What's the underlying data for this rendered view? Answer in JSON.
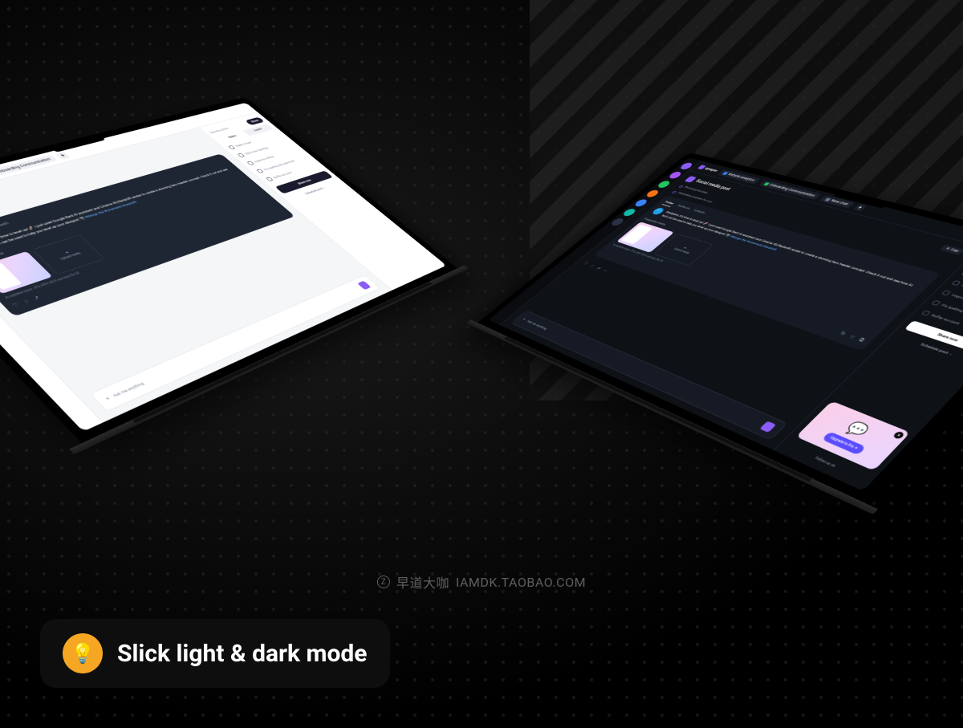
{
  "badge": {
    "text": "Slick light & dark mode"
  },
  "watermark": {
    "brand1": "早道大咖",
    "brand2": "IAMDK.TAOBAO.COM"
  },
  "app": {
    "name": "synapse",
    "tabs": [
      {
        "label": "Website analytics",
        "color": "#3b82f6"
      },
      {
        "label": "Onboarding Communication",
        "color": "#22c55e"
      }
    ],
    "dark_tab": {
      "label": "New chat"
    },
    "section_title": "Social media post",
    "steps": {
      "browsing": "Browsing the data…",
      "generating": "Generating answers for you…"
    },
    "platforms": {
      "twitter": "Twitter",
      "facebook": "Facebook",
      "linkedin": "LinkedIn"
    },
    "post_text": "Designers, it's time to level up! 🚀 I just used Google Bard AI assistant and Cinema 4D/Redshift render to create a stunning hero header concept. Check it out and see how AI tech can be used to help you level up your designs! ",
    "post_hashtags": "📷 #design #ai #cinema4d #redshift",
    "suggested_label": "Suggested media",
    "upload_label": "Upload media",
    "hint": "Acceptable types: JPG, MP4, MOV and less file 50",
    "input_placeholder": "Ask me anything",
    "sidebar": {
      "results_label": "Results action",
      "seg_builtin": "Built-in",
      "seg_custom": "Custom",
      "options": [
        {
          "label": "Make longer"
        },
        {
          "label": "Add more hashtag"
        },
        {
          "label": "Improve writing"
        },
        {
          "label": "Fix spelling and grammar"
        }
      ],
      "buffer_label": "Buffer account",
      "copy": "Copy",
      "share_now": "Share now",
      "schedule": "Schedule post",
      "share_btn": "Share",
      "promo_cta": "Upgrade to Pro ✦",
      "follow": "Follow us on"
    }
  }
}
